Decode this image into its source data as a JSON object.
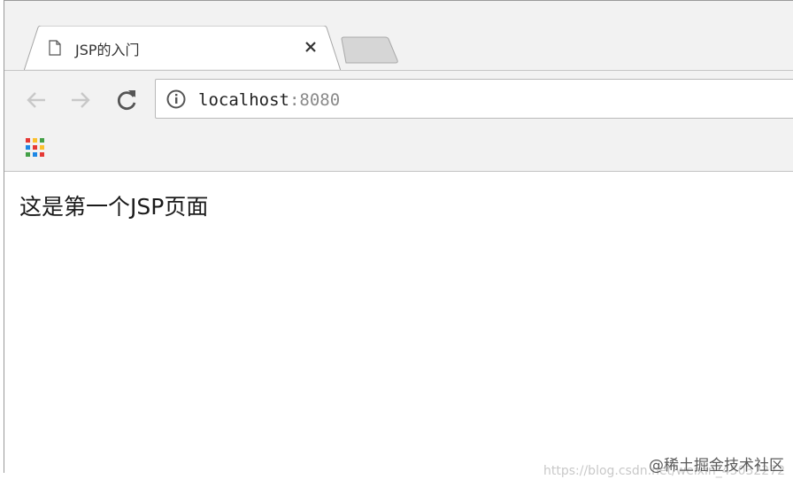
{
  "browser": {
    "tab": {
      "title": "JSP的入门",
      "close_icon": "close-icon",
      "page_icon": "document-icon"
    },
    "toolbar": {
      "back_icon": "arrow-left-icon",
      "forward_icon": "arrow-right-icon",
      "reload_icon": "reload-icon",
      "site_info_icon": "info-icon",
      "url_host": "localhost",
      "url_port": ":8080"
    },
    "bookmarks": {
      "apps_icon": "apps-grid-icon"
    },
    "colors": {
      "chrome_bg": "#f2f2f2",
      "apps_colors": [
        "#e53935",
        "#fbc02d",
        "#43a047",
        "#1e88e5"
      ]
    }
  },
  "page": {
    "body_text": "这是第一个JSP页面"
  },
  "watermark": {
    "url_text": "https://blog.csdn.net/weixin_45032272",
    "brand_text": "@稀土掘金技术社区"
  }
}
